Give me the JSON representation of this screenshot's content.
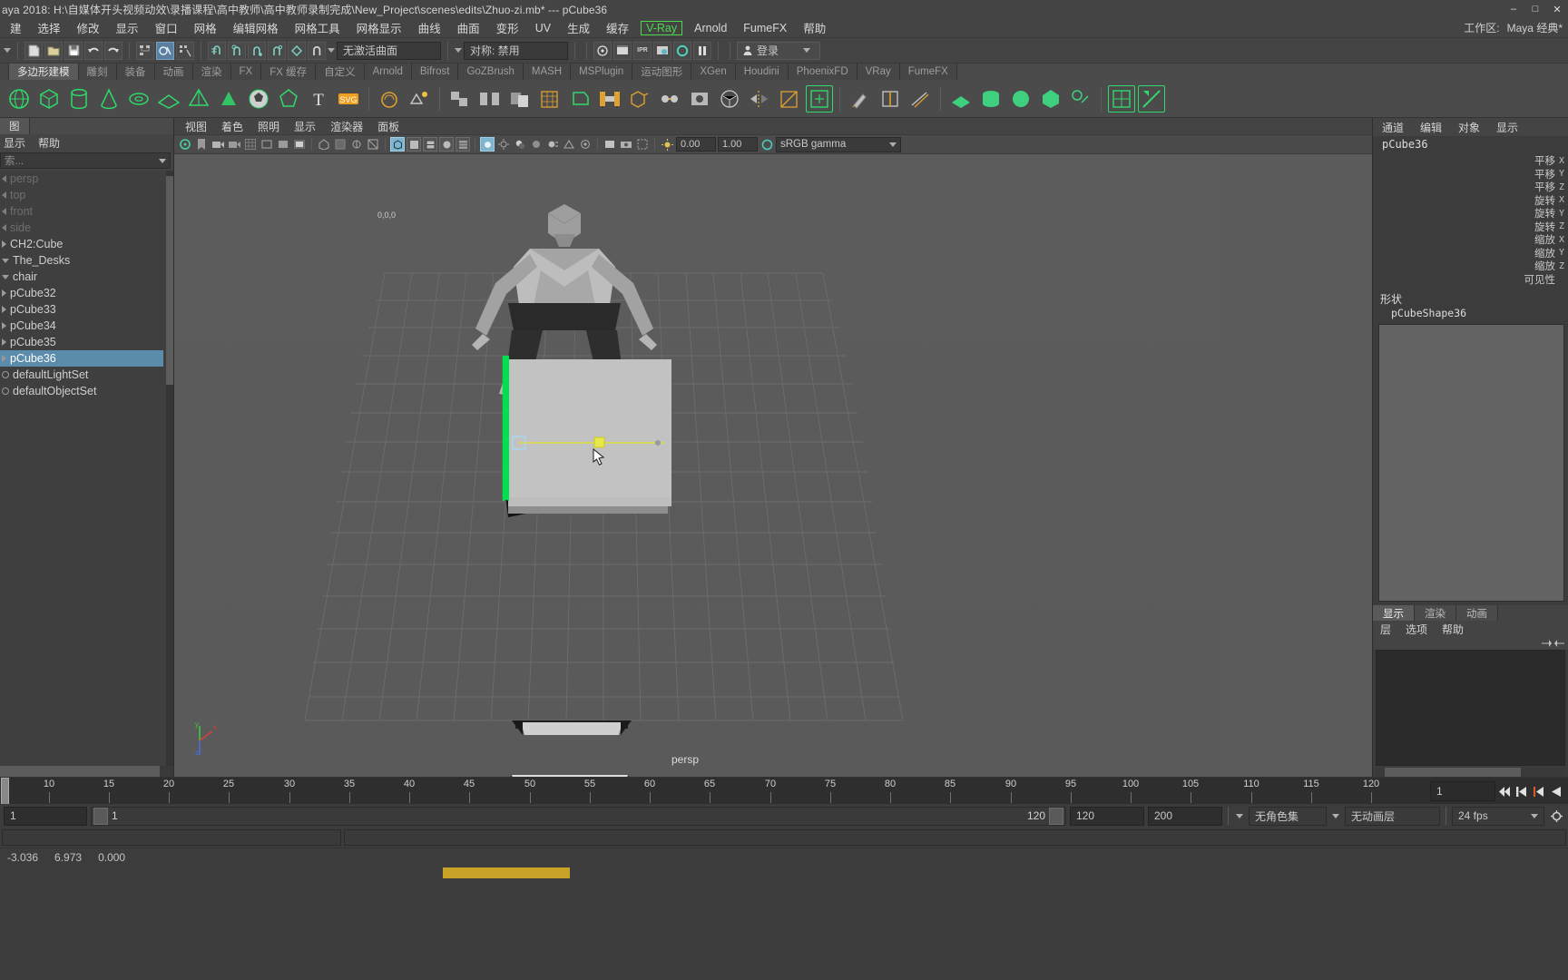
{
  "window": {
    "title": "aya 2018: H:\\自媒体开头视频动效\\录播课程\\高中教师\\高中教师录制完成\\New_Project\\scenes\\edits\\Zhuo-zi.mb*   ---   pCube36",
    "minimize": "–",
    "maximize": "□",
    "close": "✕"
  },
  "menubar": {
    "items": [
      {
        "label": "建"
      },
      {
        "label": "选择"
      },
      {
        "label": "修改"
      },
      {
        "label": "显示"
      },
      {
        "label": "窗口"
      },
      {
        "label": "网格"
      },
      {
        "label": "编辑网格"
      },
      {
        "label": "网格工具"
      },
      {
        "label": "网格显示"
      },
      {
        "label": "曲线"
      },
      {
        "label": "曲面"
      },
      {
        "label": "变形"
      },
      {
        "label": "UV"
      },
      {
        "label": "生成"
      },
      {
        "label": "缓存"
      },
      {
        "label": "V-Ray",
        "highlight": true
      },
      {
        "label": "Arnold"
      },
      {
        "label": "FumeFX"
      },
      {
        "label": "帮助"
      }
    ],
    "workspace_label": "工作区:",
    "workspace_value": "Maya 经典*"
  },
  "statusrow": {
    "selection_mask": "无激活曲面",
    "symmetry": "对称: 禁用",
    "login": "登录",
    "icons": [
      "new-scene-icon",
      "open-scene-icon",
      "save-scene-icon",
      "undo-icon",
      "redo-icon",
      "select-by-hierarchy-icon",
      "select-by-object-icon",
      "select-by-component-icon",
      "snap-grid-icon",
      "snap-curve-icon",
      "snap-point-icon",
      "snap-projected-icon",
      "snap-view-icon",
      "magnet-icon",
      "render-icon",
      "render-sequence-icon",
      "ipr-icon",
      "render-settings-icon",
      "hypershade-icon",
      "pause-icon"
    ]
  },
  "shelf": {
    "tabs": [
      {
        "label": "多边形建模",
        "active": true
      },
      {
        "label": "雕刻"
      },
      {
        "label": "装备"
      },
      {
        "label": "动画"
      },
      {
        "label": "渲染"
      },
      {
        "label": "FX"
      },
      {
        "label": "FX 缓存"
      },
      {
        "label": "自定义"
      },
      {
        "label": "Arnold"
      },
      {
        "label": "Bifrost"
      },
      {
        "label": "GoZBrush"
      },
      {
        "label": "MASH"
      },
      {
        "label": "MSPlugin"
      },
      {
        "label": "运动图形"
      },
      {
        "label": "XGen"
      },
      {
        "label": "Houdini"
      },
      {
        "label": "PhoenixFD"
      },
      {
        "label": "VRay"
      },
      {
        "label": "FumeFX"
      }
    ]
  },
  "outliner": {
    "tab_label": "图",
    "menu": [
      "显示",
      "帮助"
    ],
    "search_placeholder": "索...",
    "items": [
      {
        "label": "persp",
        "dim": true,
        "arrow": "left"
      },
      {
        "label": "top",
        "dim": true,
        "arrow": "left"
      },
      {
        "label": "front",
        "dim": true,
        "arrow": "left"
      },
      {
        "label": "side",
        "dim": true,
        "arrow": "left"
      },
      {
        "label": "CH2:Cube",
        "arrow": "right"
      },
      {
        "label": "The_Desks",
        "arrow": "down"
      },
      {
        "label": "chair",
        "arrow": "down"
      },
      {
        "label": "pCube32",
        "arrow": "right"
      },
      {
        "label": "pCube33",
        "arrow": "right"
      },
      {
        "label": "pCube34",
        "arrow": "right"
      },
      {
        "label": "pCube35",
        "arrow": "right"
      },
      {
        "label": "pCube36",
        "arrow": "right",
        "selected": true
      },
      {
        "label": "defaultLightSet",
        "arrow": "ring"
      },
      {
        "label": "defaultObjectSet",
        "arrow": "ring"
      }
    ]
  },
  "viewport": {
    "menu": [
      "视图",
      "着色",
      "照明",
      "显示",
      "渲染器",
      "面板"
    ],
    "gamma": "sRGB gamma",
    "exposure": "0.00",
    "contrast": "1.00",
    "camera_label": "persp",
    "axis": {
      "x": "x",
      "y": "y",
      "z": "z"
    },
    "origin_label": "0,0,0"
  },
  "channelbox": {
    "menu": [
      "通道",
      "编辑",
      "对象",
      "显示"
    ],
    "object_name": "pCube36",
    "attributes": [
      {
        "label": "平移",
        "axis": "X"
      },
      {
        "label": "平移",
        "axis": "Y"
      },
      {
        "label": "平移",
        "axis": "Z"
      },
      {
        "label": "旋转",
        "axis": "X"
      },
      {
        "label": "旋转",
        "axis": "Y"
      },
      {
        "label": "旋转",
        "axis": "Z"
      },
      {
        "label": "缩放",
        "axis": "X"
      },
      {
        "label": "缩放",
        "axis": "Y"
      },
      {
        "label": "缩放",
        "axis": "Z"
      },
      {
        "label": "可见性",
        "axis": ""
      }
    ],
    "shape_header": "形状",
    "shape_name": "pCubeShape36"
  },
  "layereditor": {
    "tabs": [
      {
        "label": "显示",
        "active": true
      },
      {
        "label": "渲染"
      },
      {
        "label": "动画"
      }
    ],
    "menu": [
      "层",
      "选项",
      "帮助"
    ]
  },
  "timeslider": {
    "ticks": [
      10,
      15,
      20,
      25,
      30,
      35,
      40,
      45,
      50,
      55,
      60,
      65,
      70,
      75,
      80,
      85,
      90,
      95,
      100,
      105,
      110,
      115,
      120
    ],
    "current_frame": "1",
    "playback_buttons": [
      "go-to-start-icon",
      "step-back-key-icon",
      "step-back-frame-icon",
      "play-backwards-icon"
    ]
  },
  "rangeslider": {
    "start_field": "1",
    "range_start_label": "1",
    "range_end_label": "120",
    "end_field": "120",
    "anim_end_field": "200",
    "character_set": "无角色集",
    "anim_layer": "无动画层",
    "fps": "24 fps"
  },
  "statusline": {
    "coords": [
      "-3.036",
      "6.973",
      "0.000"
    ]
  },
  "colors": {
    "accent_selection": "#5b8cab",
    "vray_green": "#4cd94c",
    "shelf_bg": "#4b4b4b",
    "panel_bg": "#3c3c3c",
    "viewport_bg": "#5b5b5b",
    "highlight_green": "#00e050"
  }
}
